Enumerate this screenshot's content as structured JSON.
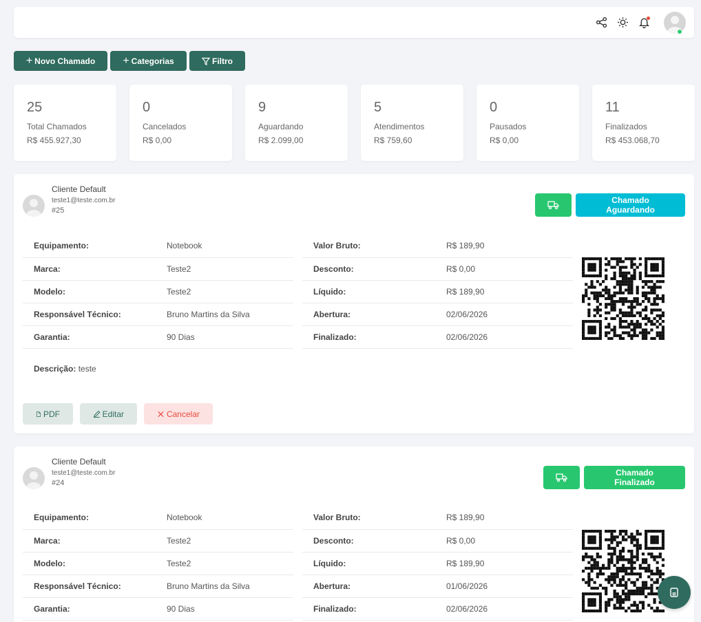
{
  "topbar": {
    "icons": [
      "share-icon",
      "sun-icon",
      "bell-icon",
      "user-avatar"
    ]
  },
  "actions": {
    "new_ticket": "Novo Chamado",
    "categories": "Categorias",
    "filter": "Filtro"
  },
  "stats": [
    {
      "count": "25",
      "label": "Total Chamados",
      "amount": "R$ 455.927,30"
    },
    {
      "count": "0",
      "label": "Cancelados",
      "amount": "R$ 0,00"
    },
    {
      "count": "9",
      "label": "Aguardando",
      "amount": "R$ 2.099,00"
    },
    {
      "count": "5",
      "label": "Atendimentos",
      "amount": "R$ 759,60"
    },
    {
      "count": "0",
      "label": "Pausados",
      "amount": "R$ 0,00"
    },
    {
      "count": "11",
      "label": "Finalizados",
      "amount": "R$ 453.068,70"
    }
  ],
  "labels": {
    "equipment": "Equipamento:",
    "brand": "Marca:",
    "model": "Modelo:",
    "technician": "Responsável Técnico:",
    "warranty": "Garantia:",
    "gross": "Valor Bruto:",
    "discount": "Desconto:",
    "net": "Líquido:",
    "opening": "Abertura:",
    "closed": "Finalizado:",
    "description": "Descrição:",
    "pdf": "PDF",
    "edit": "Editar",
    "cancel": "Cancelar"
  },
  "tickets": [
    {
      "client_name": "Cliente Default",
      "client_email": "teste1@teste.com.br",
      "id": "#25",
      "status": "Chamado Aguardando",
      "status_color": "#00bcd4",
      "equipment": "Notebook",
      "brand": "Teste2",
      "model": "Teste2",
      "technician": "Bruno Martins da Silva",
      "warranty": "90 Dias",
      "gross": "R$ 189,90",
      "discount": "R$ 0,00",
      "net": "R$ 189,90",
      "opening": "02/06/2026",
      "closed": "02/06/2026",
      "description": "teste"
    },
    {
      "client_name": "Cliente Default",
      "client_email": "teste1@teste.com.br",
      "id": "#24",
      "status": "Chamado Finalizado",
      "status_color": "#28c76f",
      "equipment": "Notebook",
      "brand": "Teste2",
      "model": "Teste2",
      "technician": "Bruno Martins da Silva",
      "warranty": "90 Dias",
      "gross": "R$ 189,90",
      "discount": "R$ 0,00",
      "net": "R$ 189,90",
      "opening": "01/06/2026",
      "closed": "02/06/2026"
    }
  ],
  "colors": {
    "primary": "#2f6b5e",
    "success": "#28c76f",
    "info": "#00bcd4",
    "danger": "#e74c3c"
  }
}
